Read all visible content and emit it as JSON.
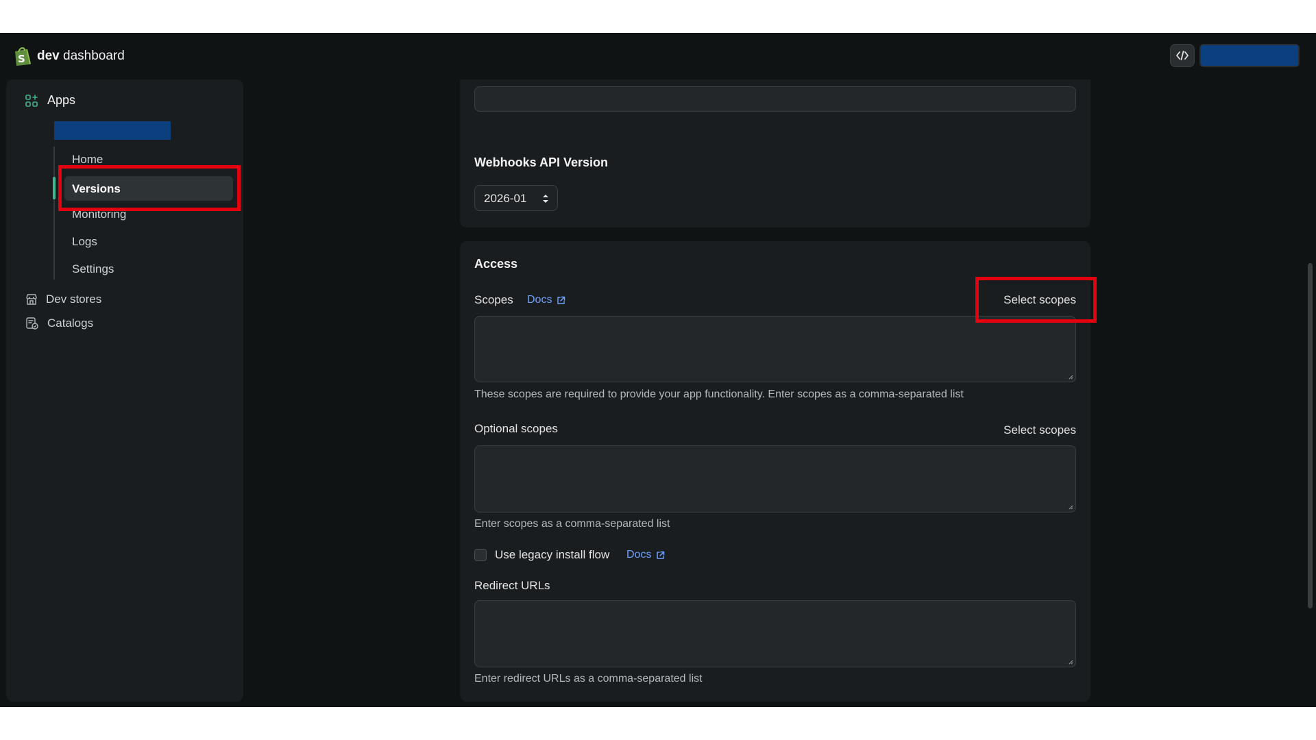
{
  "brand": {
    "bold": "dev",
    "rest": " dashboard"
  },
  "topbar": {
    "code_icon": "code-icon"
  },
  "sidebar": {
    "apps_label": "Apps",
    "subitems": [
      "Home",
      "Versions",
      "Monitoring",
      "Logs",
      "Settings"
    ],
    "active_subitem": "Versions",
    "items": [
      {
        "label": "Dev stores",
        "icon": "store-icon"
      },
      {
        "label": "Catalogs",
        "icon": "catalog-icon"
      }
    ]
  },
  "webhooks": {
    "title": "Webhooks API Version",
    "version": "2026-01"
  },
  "access": {
    "title": "Access",
    "scopes_label": "Scopes",
    "docs_label": "Docs",
    "select_scopes_label": "Select scopes",
    "scopes_help": "These scopes are required to provide your app functionality. Enter scopes as a comma-separated list",
    "optional_label": "Optional scopes",
    "optional_select_label": "Select scopes",
    "optional_help": "Enter scopes as a comma-separated list",
    "legacy_label": "Use legacy install flow",
    "legacy_docs_label": "Docs",
    "redirect_label": "Redirect URLs",
    "redirect_help": "Enter redirect URLs as a comma-separated list"
  },
  "colors": {
    "background": "#101314",
    "card": "#1a1d1f",
    "accent": "#3fb68b",
    "link": "#6ea2ff",
    "highlight": "#e3000f",
    "redacted": "#0c3f7e"
  }
}
